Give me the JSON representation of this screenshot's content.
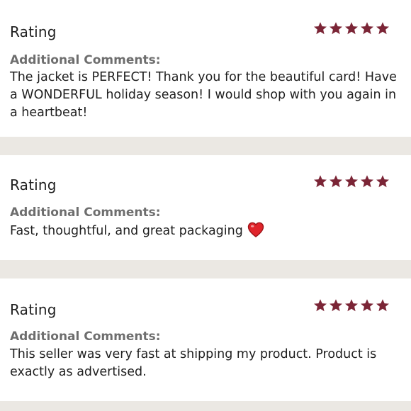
{
  "reviews": [
    {
      "rating_label": "Rating",
      "stars": 5,
      "comments_heading": "Additional Comments:",
      "comment": "The jacket is PERFECT! Thank you for the beautiful card! Have a WONDERFUL holiday season! I would shop with you again in a heartbeat!"
    },
    {
      "rating_label": "Rating",
      "stars": 5,
      "comments_heading": "Additional Comments:",
      "comment": "Fast, thoughtful, and great packaging",
      "emoji": "heart-icon"
    },
    {
      "rating_label": "Rating",
      "stars": 5,
      "comments_heading": "Additional Comments:",
      "comment": "This seller was very fast at shipping my product. Product is exactly as advertised."
    }
  ],
  "colors": {
    "star": "#7b2536",
    "background": "#ebe8e3",
    "card": "#ffffff",
    "heading": "#6e6e6e",
    "text": "#1f1f1f",
    "heart": "#e0242b"
  }
}
